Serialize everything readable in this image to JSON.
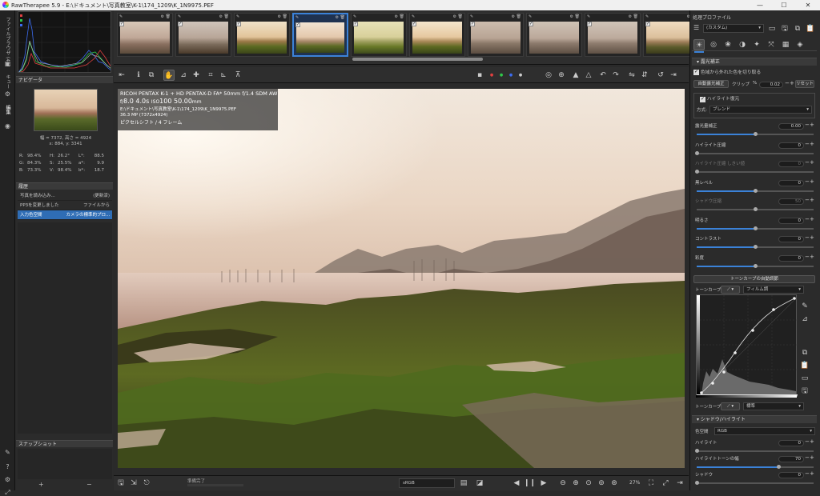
{
  "window": {
    "title": "RawTherapee 5.9 - E:\\ドキュメント\\写真教室\\K-1\\174_1209\\K_1N9975.PEF",
    "controls": [
      "—",
      "☐",
      "✕"
    ]
  },
  "left_tabs": [
    "ファイルブラウザ (41)",
    "キュー",
    "編集"
  ],
  "navigator": {
    "title": "ナビゲータ",
    "size_text": "幅 = 7372, 高さ = 4924",
    "coords_text": "x: 884, y: 3341",
    "rgb": [
      {
        "k": "R:",
        "v": "98.4%",
        "k2": "H:",
        "v2": "26.2°",
        "k3": "L*:",
        "v3": "88.5"
      },
      {
        "k": "G:",
        "v": "84.3%",
        "k2": "S:",
        "v2": "25.5%",
        "k3": "a*:",
        "v3": "9.9"
      },
      {
        "k": "B:",
        "v": "73.3%",
        "k2": "V:",
        "v2": "98.4%",
        "k3": "b*:",
        "v3": "18.7"
      }
    ]
  },
  "history": {
    "title": "履歴",
    "rows": [
      {
        "a": "写真を読み込み...",
        "b": "(更新済)"
      },
      {
        "a": "PP3を変更しました",
        "b": "ファイルから"
      },
      {
        "a": "入力色空間",
        "b": "カメラの標準的プロ..."
      }
    ]
  },
  "snapshot": {
    "title": "スナップショット",
    "add": "+",
    "remove": "−"
  },
  "image_info": {
    "camera": "RICOH PENTAX K-1 + HD PENTAX-D FA* 50mm f/1.4 SDM AW",
    "exposure_prefix": "f/",
    "aperture": "8.0",
    "shutter": "4.0s",
    "iso_label": "ISO",
    "iso": "100",
    "focal": "50.00",
    "focal_unit": "mm",
    "path": "E:\\ドキュメント\\写真教室\\K-1\\174_1209\\K_1N9975.PEF",
    "mp": "36.3 MP (7372x4924)",
    "mode": "ピクセルシフト / 4 フレーム"
  },
  "status": {
    "text": "準備完了",
    "zoom": "27%",
    "profile": "sRGB"
  },
  "right": {
    "profile_title": "処理プロファイル",
    "profile_value": "(カスタム)",
    "section_exposure": "露光補正",
    "clip_label": "色域から外れた色を切り取る",
    "auto_label": "自動露光補正",
    "clip_text": "クリップ",
    "clip_pct": "%",
    "clip_val": "0.02",
    "reset": "リセット",
    "hl_recovery": "ハイライト復元",
    "method_label": "方式:",
    "method_value": "ブレンド",
    "sliders": [
      {
        "label": "露光量補正",
        "value": "0.00",
        "pos": 0.5
      },
      {
        "label": "ハイライト圧縮",
        "value": "0",
        "pos": 0.0
      },
      {
        "label": "ハイライト圧縮 しきい値",
        "value": "0",
        "pos": 0.0,
        "dim": true
      },
      {
        "label": "黒レベル",
        "value": "0",
        "pos": 0.5
      },
      {
        "label": "シャドウ圧縮",
        "value": "50",
        "pos": 0.5,
        "dim": true
      },
      {
        "label": "明るさ",
        "value": "0",
        "pos": 0.5
      },
      {
        "label": "コントラスト",
        "value": "0",
        "pos": 0.5
      },
      {
        "label": "彩度",
        "value": "0",
        "pos": 0.5
      }
    ],
    "tone_curve_btn": "トーンカーブの自動調節",
    "curve1_label": "トーンカーブ 1",
    "curve1_type": "フィルム調",
    "curve2_label": "トーンカーブ 2",
    "curve2_type": "標準",
    "section_shadow": "シャドウ/ハイライト",
    "color_space_label": "色空間",
    "color_space": "RGB",
    "sh_sliders": [
      {
        "label": "ハイライト",
        "value": "0",
        "pos": 0.0
      },
      {
        "label": "ハイライトトーンの幅",
        "value": "70",
        "pos": 0.7
      },
      {
        "label": "シャドウ",
        "value": "0",
        "pos": 0.0
      }
    ]
  },
  "filmstrip": {
    "thumbs": 10,
    "selected_index": 3
  },
  "colors": {
    "accent": "#3b82d8",
    "panel": "#2b2b2b"
  }
}
